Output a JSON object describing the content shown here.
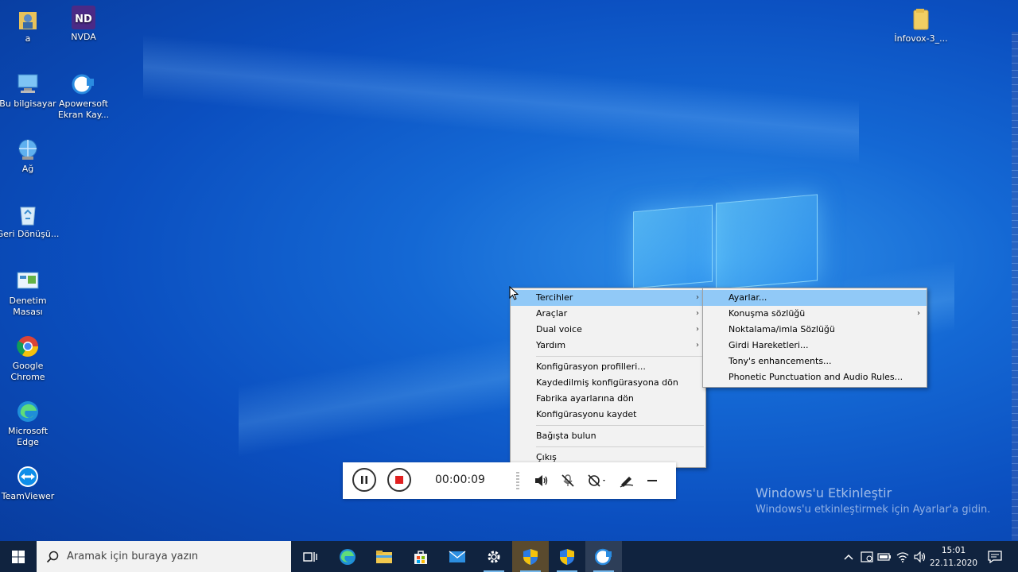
{
  "desktop": {
    "icons": [
      {
        "label": "a",
        "icon": "user-folder-icon"
      },
      {
        "label": "NVDA",
        "icon": "nvda-icon"
      },
      {
        "label": "Bu bilgisayar",
        "icon": "computer-icon"
      },
      {
        "label": "Apowersoft Ekran Kay...",
        "icon": "apowersoft-icon"
      },
      {
        "label": "Ağ",
        "icon": "network-icon"
      },
      {
        "label": "Geri Dönüşü...",
        "icon": "recycle-bin-icon"
      },
      {
        "label": "Denetim Masası",
        "icon": "control-panel-icon"
      },
      {
        "label": "Google Chrome",
        "icon": "chrome-icon"
      },
      {
        "label": "Microsoft Edge",
        "icon": "edge-icon"
      },
      {
        "label": "TeamViewer",
        "icon": "teamviewer-icon"
      },
      {
        "label": "İnfovox-3_...",
        "icon": "folder-icon"
      }
    ]
  },
  "context_menu": {
    "items": [
      {
        "label": "Tercihler",
        "submenu": true,
        "highlighted": true
      },
      {
        "label": "Araçlar",
        "submenu": true
      },
      {
        "label": "Dual voice",
        "submenu": true
      },
      {
        "label": "Yardım",
        "submenu": true
      },
      {
        "label": "Konfigürasyon profilleri..."
      },
      {
        "label": "Kaydedilmiş konfigürasyona dön"
      },
      {
        "label": "Fabrika ayarlarına dön"
      },
      {
        "label": "Konfigürasyonu kaydet"
      },
      {
        "label": "Bağışta bulun"
      },
      {
        "label": "Çıkış"
      }
    ]
  },
  "submenu": {
    "items": [
      {
        "label": "Ayarlar...",
        "highlighted": true
      },
      {
        "label": "Konuşma sözlüğü",
        "submenu": true
      },
      {
        "label": "Noktalama/imla Sözlüğü"
      },
      {
        "label": "Girdi Hareketleri..."
      },
      {
        "label": "Tony's enhancements..."
      },
      {
        "label": "Phonetic Punctuation and Audio Rules..."
      }
    ]
  },
  "recorder": {
    "time": "00:00:09",
    "controls": [
      "pause-icon",
      "stop-icon",
      "speaker-icon",
      "mic-off-icon",
      "camera-off-icon",
      "pen-icon",
      "minimize-icon"
    ],
    "accent": "#e02020"
  },
  "watermark": {
    "title": "Windows'u Etkinleştir",
    "subtitle": "Windows'u etkinleştirmek için Ayarlar'a gidin."
  },
  "taskbar": {
    "search_placeholder": "Aramak için buraya yazın",
    "apps": [
      "task-view-icon",
      "edge-icon",
      "file-explorer-icon",
      "store-icon",
      "mail-icon",
      "settings-icon",
      "shield-icon",
      "shield-icon",
      "recorder-icon"
    ],
    "time": "15:01",
    "date": "22.11.2020",
    "colors": {
      "bar": "#10233f",
      "active": "#5a4a2e"
    }
  }
}
